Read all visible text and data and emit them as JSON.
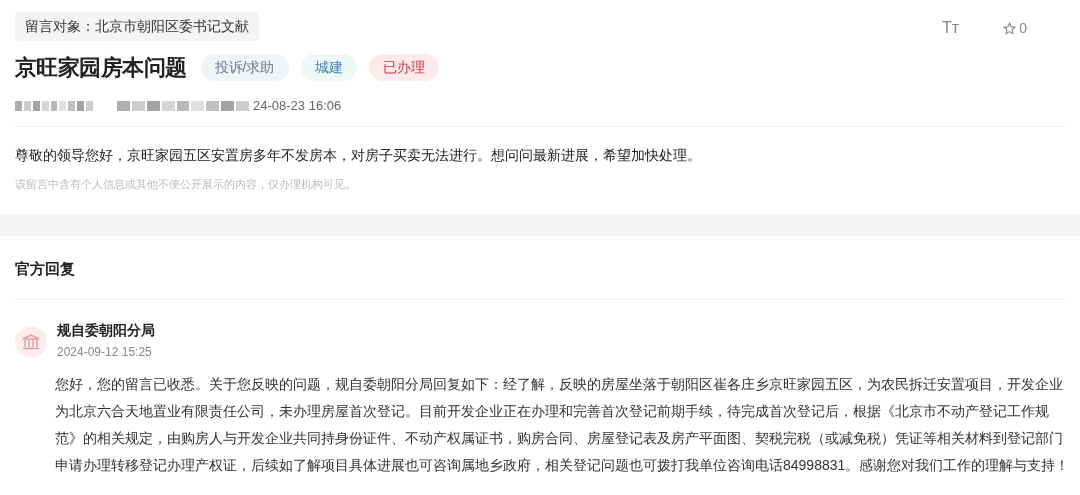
{
  "target": "留言对象：北京市朝阳区委书记文献",
  "toolbar": {
    "font_size": "Tт",
    "favorites": "0"
  },
  "title": "京旺家园房本问题",
  "tags": [
    {
      "label": "投诉/求助",
      "kind": "type"
    },
    {
      "label": "城建",
      "kind": "field"
    },
    {
      "label": "已办理",
      "kind": "status"
    }
  ],
  "meta": {
    "time": "24-08-23 16:06"
  },
  "message": "尊敬的领导您好，京旺家园五区安置房多年不发房本，对房子买卖无法进行。想问问最新进展，希望加快处理。",
  "privacy_note": "该留言中含有个人信息或其他不便公开展示的内容，仅办理机构可见。",
  "reply_section": {
    "heading": "官方回复",
    "reply": {
      "department": "规自委朝阳分局",
      "time": "2024-09-12 15:25",
      "text": "您好，您的留言已收悉。关于您反映的问题，规自委朝阳分局回复如下：经了解，反映的房屋坐落于朝阳区崔各庄乡京旺家园五区，为农民拆迁安置项目，开发企业为北京六合天地置业有限责任公司，未办理房屋首次登记。目前开发企业正在办理和完善首次登记前期手续，待完成首次登记后，根据《北京市不动产登记工作规范》的相关规定，由购房人与开发企业共同持身份证件、不动产权属证书，购房合同、房屋登记表及房产平面图、契税完税（或减免税）凭证等相关材料到登记部门申请办理转移登记办理产权证，后续如了解项目具体进展也可咨询属地乡政府，相关登记问题也可拨打我单位咨询电话84998831。感谢您对我们工作的理解与支持！"
    }
  }
}
